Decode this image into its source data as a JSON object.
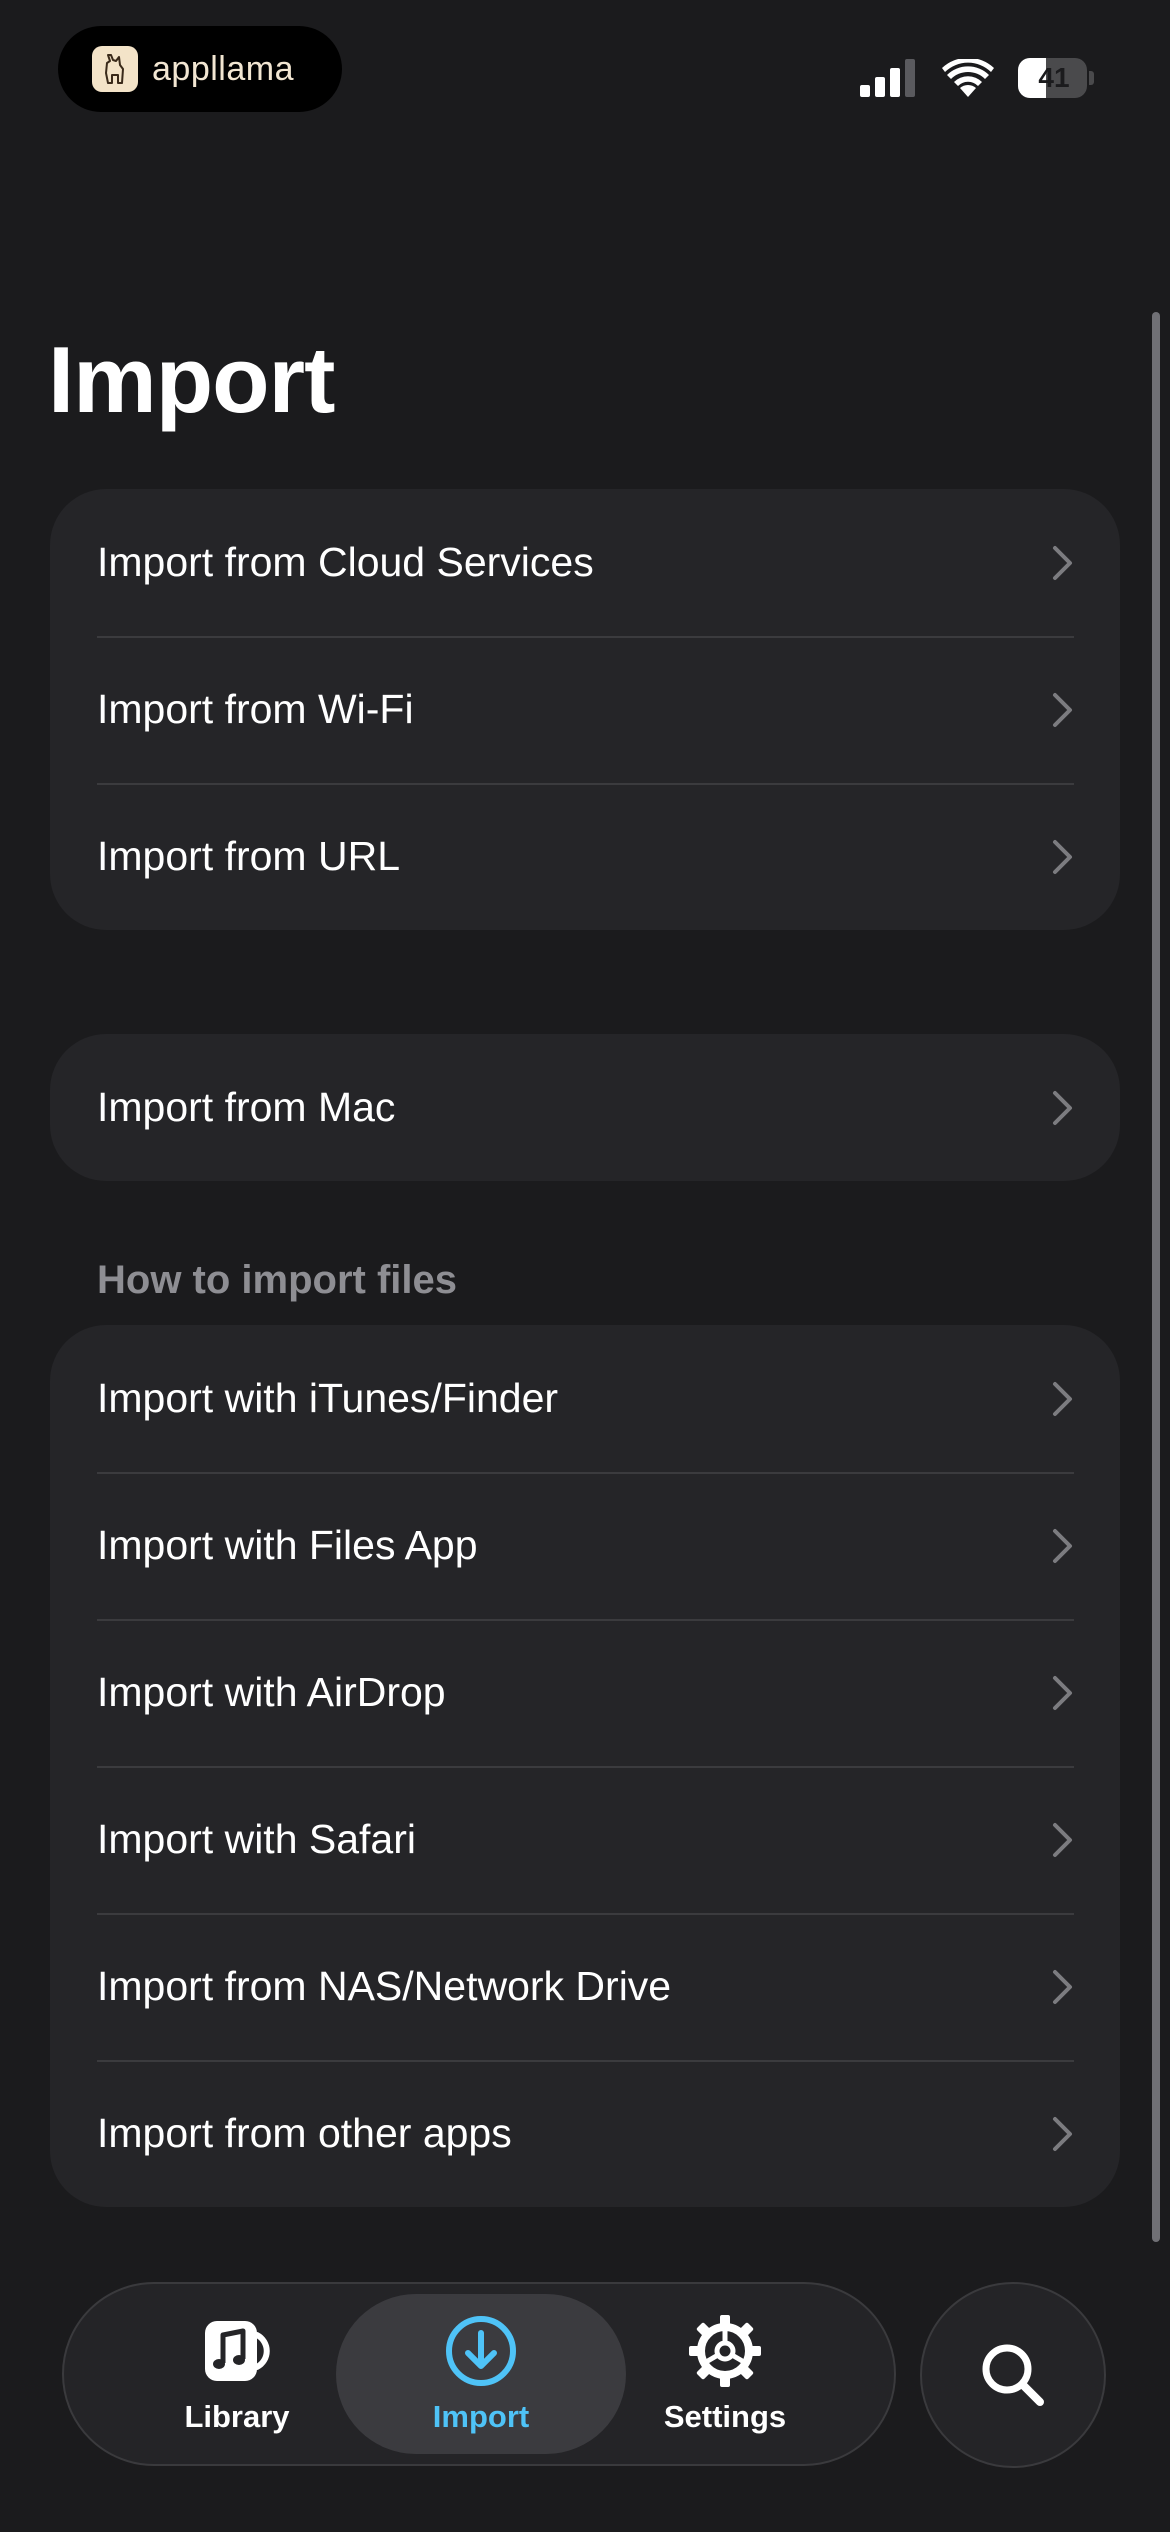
{
  "status_bar": {
    "app_name": "appllama",
    "app_icon": "llama-logo-icon",
    "signal_icon": "cellular-signal-icon",
    "wifi_icon": "wifi-icon",
    "battery_level": "41",
    "battery_fraction": 0.41
  },
  "page": {
    "title": "Import"
  },
  "group_import_sources": {
    "items": [
      {
        "label": "Import from Cloud Services"
      },
      {
        "label": "Import from Wi-Fi"
      },
      {
        "label": "Import from URL"
      }
    ]
  },
  "group_mac": {
    "items": [
      {
        "label": "Import from Mac"
      }
    ]
  },
  "section_how_to": {
    "header": "How to import files",
    "items": [
      {
        "label": "Import with iTunes/Finder"
      },
      {
        "label": "Import with Files App"
      },
      {
        "label": "Import with AirDrop"
      },
      {
        "label": "Import with Safari"
      },
      {
        "label": "Import from NAS/Network Drive"
      },
      {
        "label": "Import from other apps"
      }
    ]
  },
  "tab_bar": {
    "tabs": [
      {
        "label": "Library",
        "icon": "music-note-icon",
        "active": false
      },
      {
        "label": "Import",
        "icon": "download-circle-icon",
        "active": true
      },
      {
        "label": "Settings",
        "icon": "gear-icon",
        "active": false
      }
    ],
    "search_icon": "search-icon"
  },
  "colors": {
    "background": "#1b1b1d",
    "card": "#252528",
    "accent": "#4fc3f7",
    "secondary_text": "#8e8e93"
  }
}
